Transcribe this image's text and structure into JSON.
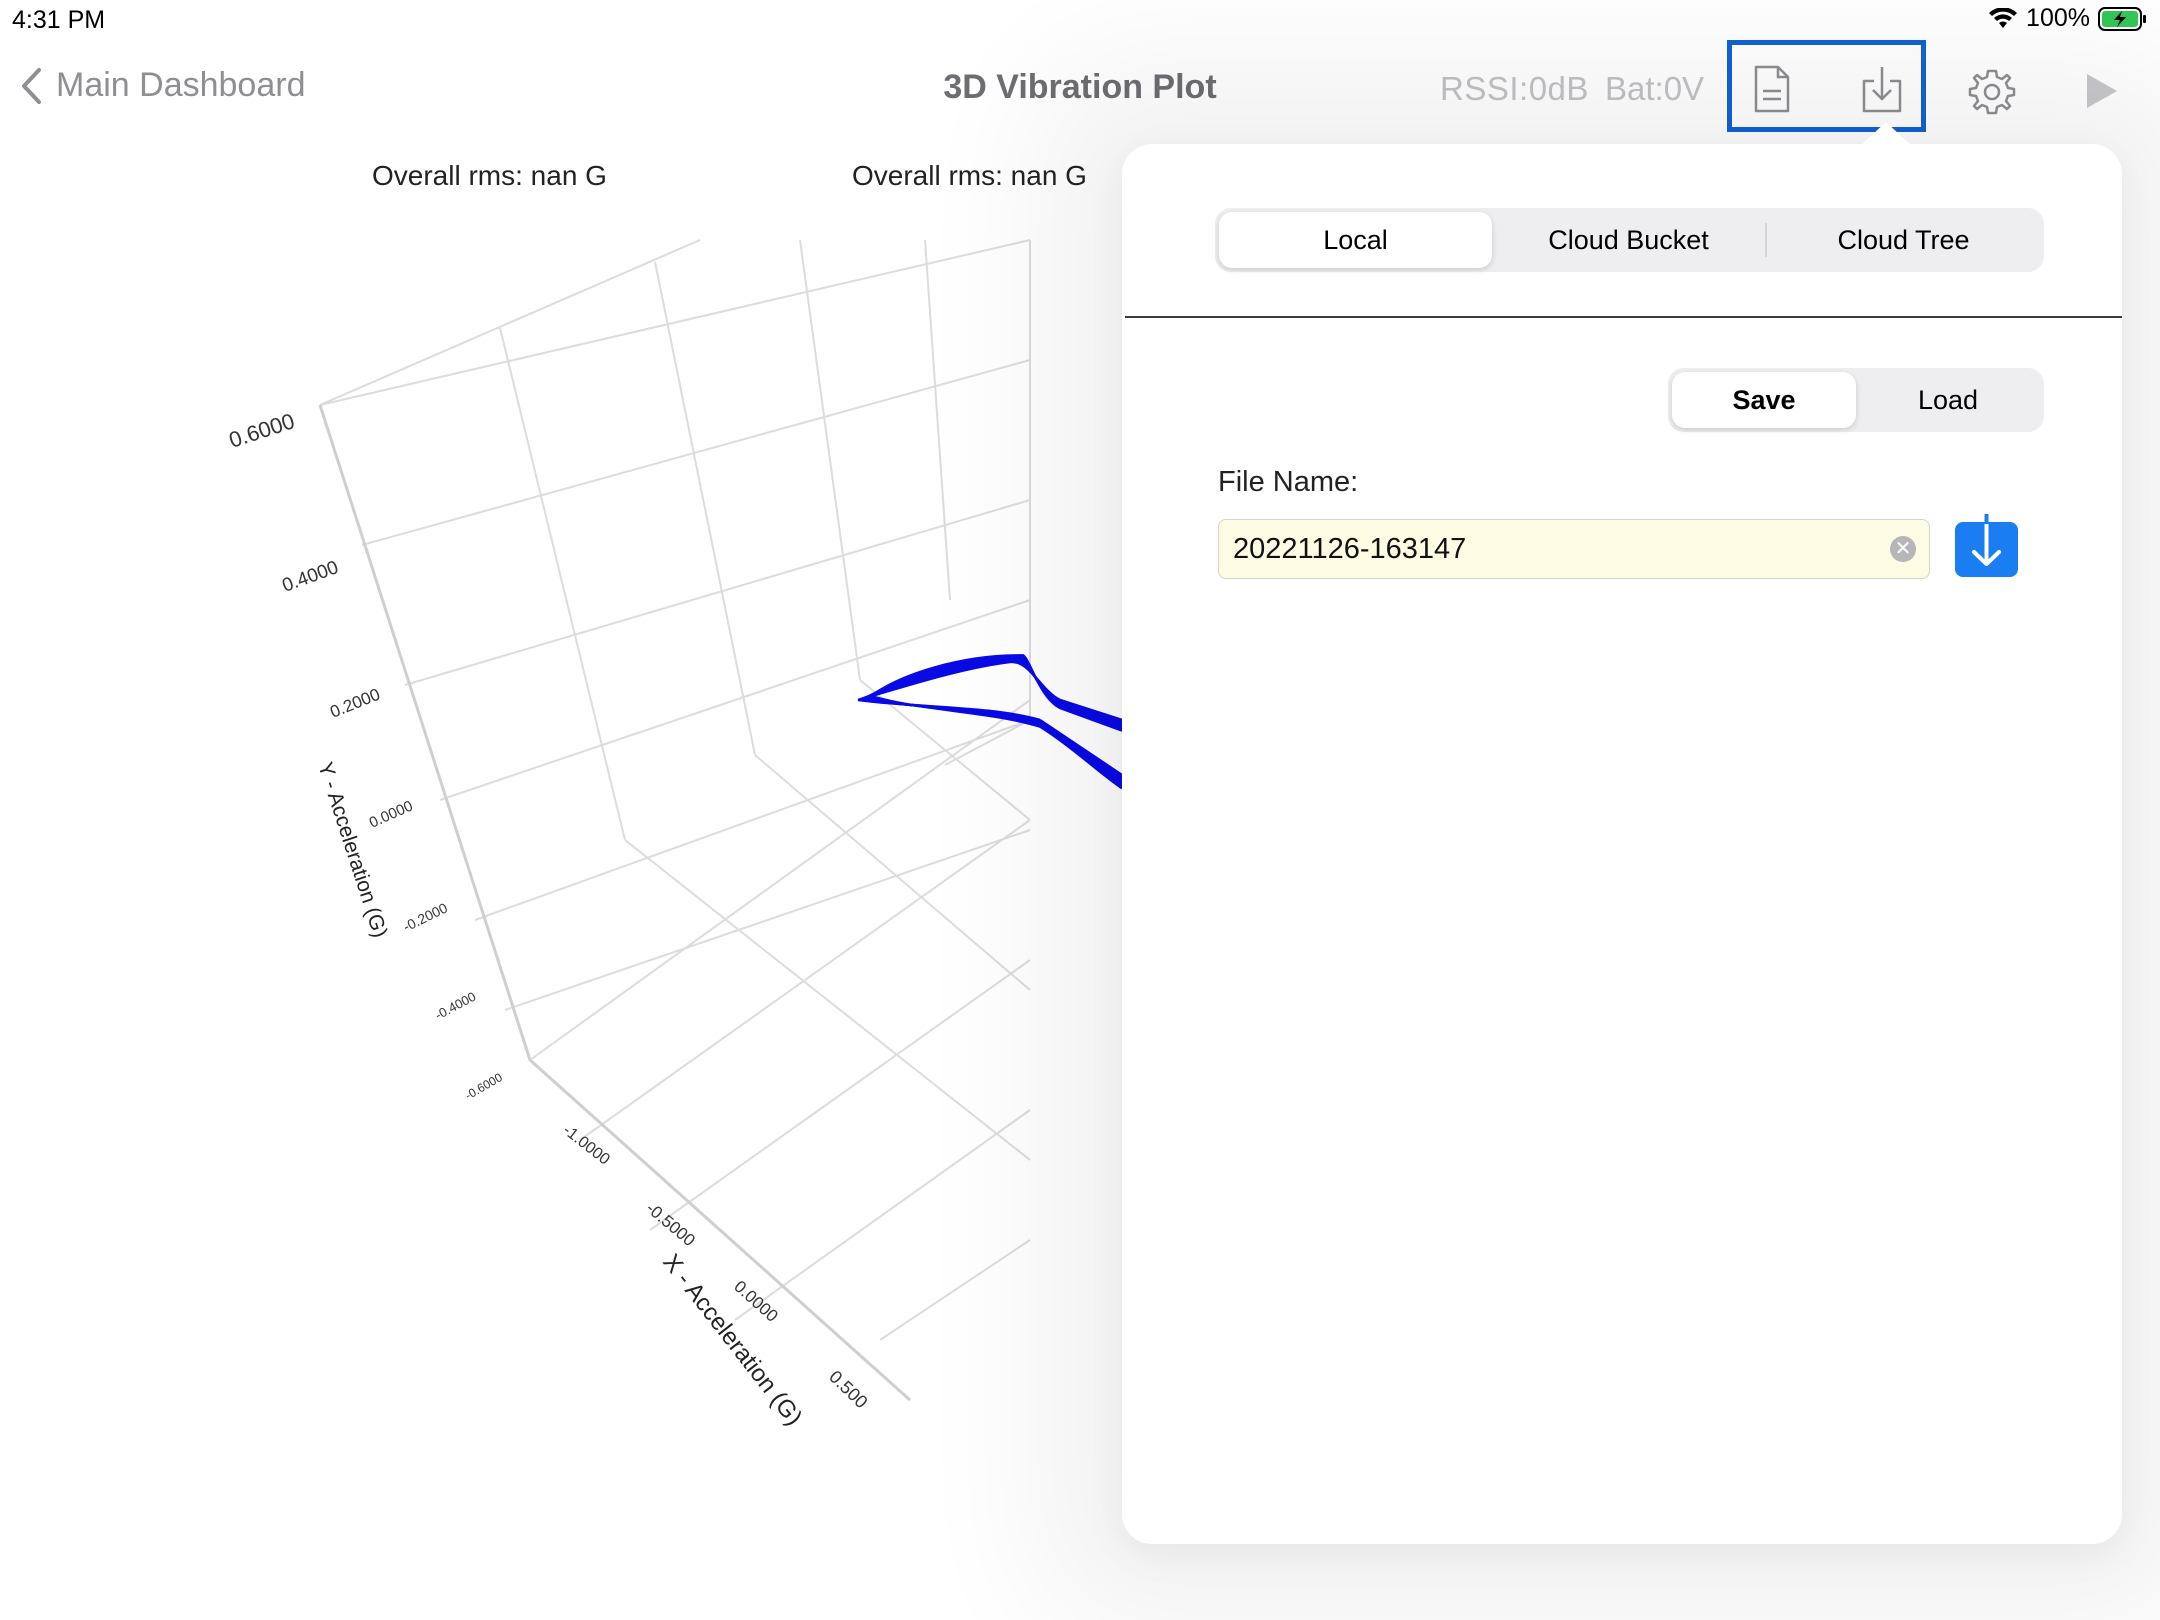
{
  "status_bar": {
    "time": "4:31 PM",
    "battery": "100%"
  },
  "nav": {
    "back_label": "Main Dashboard",
    "title": "3D Vibration Plot",
    "rssi": "RSSI:0dB",
    "battery": "Bat:0V"
  },
  "plot": {
    "rms_left": "Overall rms: nan G",
    "rms_right": "Overall rms: nan G",
    "y_axis_label": "Y - Acceleration (G)",
    "x_axis_label": "X - Acceleration (G)",
    "y_ticks": [
      "0.6000",
      "0.4000",
      "0.2000",
      "0.0000",
      "-0.2000",
      "-0.4000",
      "-0.6000"
    ],
    "x_ticks": [
      "-1.0000",
      "-0.5000",
      "0.0000",
      "0.500"
    ],
    "trace_color": "#0a0ae6"
  },
  "popover": {
    "source_tabs": [
      "Local",
      "Cloud Bucket",
      "Cloud Tree"
    ],
    "active_source": "Local",
    "mode_tabs": [
      "Save",
      "Load"
    ],
    "active_mode": "Save",
    "file_label": "File Name:",
    "file_name": "20221126-163147"
  },
  "colors": {
    "accent": "#1a7df2",
    "highlight": "#1262d5"
  }
}
